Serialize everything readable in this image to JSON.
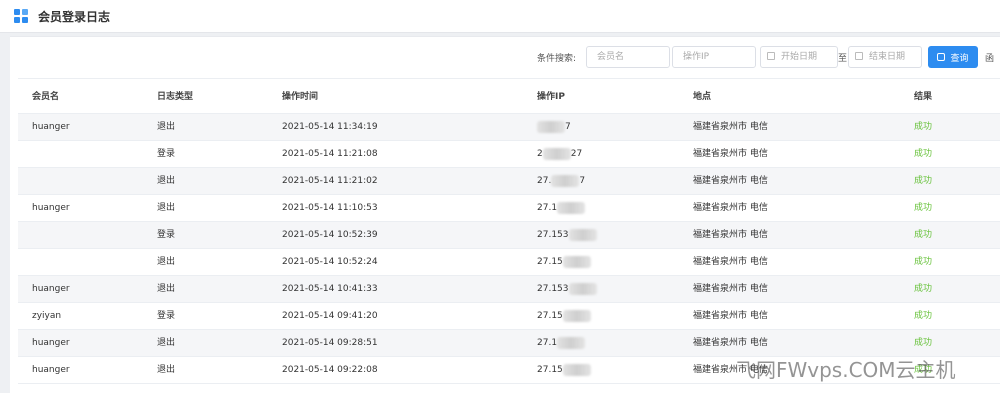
{
  "header": {
    "title": "会员登录日志"
  },
  "search": {
    "label": "条件搜索:",
    "name_placeholder": "会员名",
    "ip_placeholder": "操作IP",
    "start_placeholder": "开始日期",
    "to_label": "至",
    "end_placeholder": "结束日期",
    "button_label": "查询",
    "more_label": "函"
  },
  "table": {
    "columns": [
      "会员名",
      "日志类型",
      "操作时间",
      "操作IP",
      "地点",
      "结果"
    ],
    "rows": [
      {
        "member": "huanger",
        "type": "退出",
        "time": "2021-05-14 11:34:19",
        "ip_prefix": "",
        "ip_suffix": "7",
        "location": "福建省泉州市 电信",
        "result": "成功"
      },
      {
        "member": "",
        "type": "登录",
        "time": "2021-05-14 11:21:08",
        "ip_prefix": "2",
        "ip_suffix": "27",
        "location": "福建省泉州市 电信",
        "result": "成功"
      },
      {
        "member": "",
        "type": "退出",
        "time": "2021-05-14 11:21:02",
        "ip_prefix": "27.",
        "ip_suffix": "7",
        "location": "福建省泉州市 电信",
        "result": "成功"
      },
      {
        "member": "huanger",
        "type": "退出",
        "time": "2021-05-14 11:10:53",
        "ip_prefix": "27.1",
        "ip_suffix": "",
        "location": "福建省泉州市 电信",
        "result": "成功"
      },
      {
        "member": "",
        "type": "登录",
        "time": "2021-05-14 10:52:39",
        "ip_prefix": "27.153",
        "ip_suffix": "",
        "location": "福建省泉州市 电信",
        "result": "成功"
      },
      {
        "member": "",
        "type": "退出",
        "time": "2021-05-14 10:52:24",
        "ip_prefix": "27.15",
        "ip_suffix": "",
        "location": "福建省泉州市 电信",
        "result": "成功"
      },
      {
        "member": "huanger",
        "type": "退出",
        "time": "2021-05-14 10:41:33",
        "ip_prefix": "27.153",
        "ip_suffix": "",
        "location": "福建省泉州市 电信",
        "result": "成功"
      },
      {
        "member": "zyiyan",
        "type": "登录",
        "time": "2021-05-14 09:41:20",
        "ip_prefix": "27.15",
        "ip_suffix": "",
        "location": "福建省泉州市 电信",
        "result": "成功"
      },
      {
        "member": "huanger",
        "type": "退出",
        "time": "2021-05-14 09:28:51",
        "ip_prefix": "27.1",
        "ip_suffix": "",
        "location": "福建省泉州市 电信",
        "result": "成功"
      },
      {
        "member": "huanger",
        "type": "退出",
        "time": "2021-05-14 09:22:08",
        "ip_prefix": "27.15",
        "ip_suffix": "",
        "location": "福建省泉州市 电信",
        "result": "成功"
      }
    ]
  },
  "watermark": "飞网FWvps.COM云主机",
  "colors": {
    "accent": "#2d8cf0",
    "success": "#67c23a"
  }
}
